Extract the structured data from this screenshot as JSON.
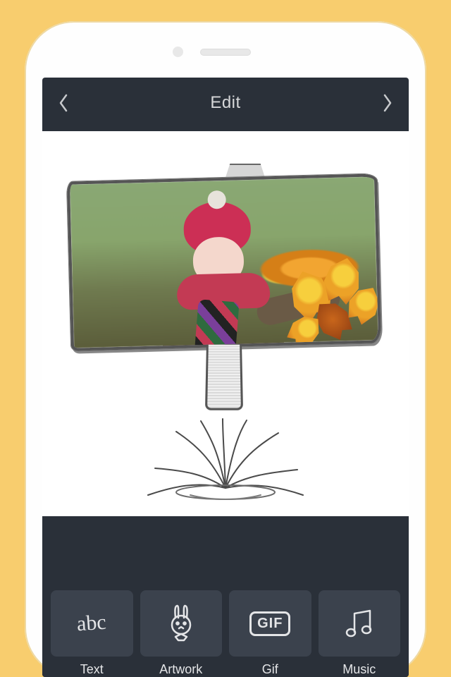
{
  "header": {
    "title": "Edit"
  },
  "canvas": {
    "frame_style": "sketched-signboard",
    "subject": "toddler-with-autumn-leaves"
  },
  "toolbar": {
    "items": [
      {
        "label": "Text",
        "icon_text": "abc"
      },
      {
        "label": "Artwork",
        "icon_text": ""
      },
      {
        "label": "Gif",
        "icon_text": "GIF"
      },
      {
        "label": "Music",
        "icon_text": ""
      }
    ]
  },
  "colors": {
    "page_bg": "#f8cd6e",
    "screen_bg": "#2a3039",
    "tile_bg": "#3b424d",
    "text": "#e4e5e7"
  }
}
